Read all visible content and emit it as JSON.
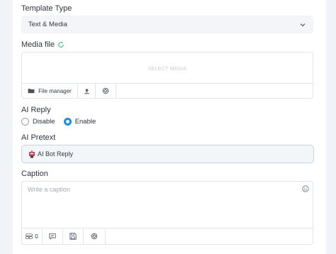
{
  "template_type": {
    "label": "Template Type",
    "selected": "Text & Media"
  },
  "media_file": {
    "label": "Media file",
    "placeholder": "SELECT MEDIA",
    "toolbar": {
      "file_manager_label": "File manager"
    }
  },
  "ai_reply": {
    "label": "AI Reply",
    "options": [
      "Disable",
      "Enable"
    ],
    "selected": "Enable"
  },
  "ai_pretext": {
    "label": "AI Pretext",
    "value": "AI Bot Reply"
  },
  "caption": {
    "label": "Caption",
    "placeholder": "Write a caption",
    "toolbar": {
      "button_count": "0"
    }
  },
  "colors": {
    "accent": "#1a8fe3",
    "refresh_icon": "#3fbf7f",
    "border": "#e1e5ec"
  }
}
